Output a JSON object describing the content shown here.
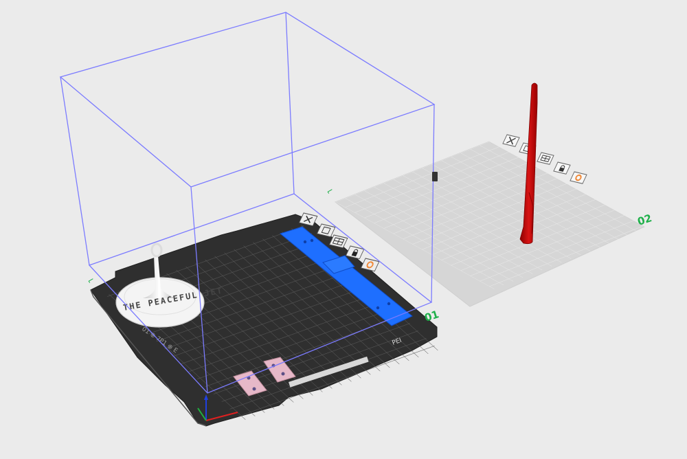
{
  "viewport": {
    "background": "#ebebeb",
    "bed_color": "#2f2f2f",
    "bed_grid_color": "#5a5a5a",
    "ghost_bed_color": "#d6d6d6",
    "ghost_grid_color": "#e6e6e6",
    "build_volume_color": "#7b7bff",
    "selection_color": "#7b7bff"
  },
  "plates": [
    {
      "label": "01",
      "active": true,
      "label_color": "#1fb04a",
      "buttons": [
        "close-icon",
        "arrange-icon",
        "layout-icon",
        "lock-icon",
        "settings-icon"
      ]
    },
    {
      "label": "02",
      "active": false,
      "label_color": "#1fb04a",
      "buttons": [
        "close-icon",
        "arrange-icon",
        "layout-icon",
        "lock-icon",
        "settings-icon"
      ]
    }
  ],
  "models": [
    {
      "name": "disc-stand",
      "color": "#f2f2f2",
      "engraving_text": "THE PEACEFUL JET"
    },
    {
      "name": "blue-bracket",
      "color": "#1e6fff"
    },
    {
      "name": "pink-clip",
      "color": "#e6b8c8"
    },
    {
      "name": "pink-clip",
      "color": "#e6b8c8"
    },
    {
      "name": "red-rod",
      "color": "#c81010"
    }
  ],
  "bed_text": {
    "corner_tag": "PEI",
    "side_text": "01 ⊕ 7P1 ⊕ E"
  },
  "axis_colors": {
    "x": "#e02020",
    "y": "#20b040",
    "z": "#2040e0"
  }
}
